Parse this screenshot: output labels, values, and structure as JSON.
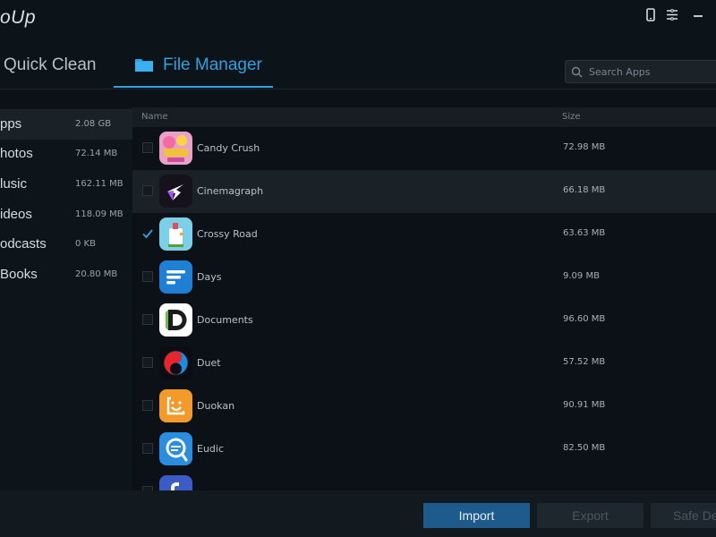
{
  "app": {
    "title": "oUp"
  },
  "tabs": [
    {
      "label": "Quick Clean",
      "active": false
    },
    {
      "label": "File Manager",
      "active": true
    }
  ],
  "search": {
    "placeholder": "Search Apps",
    "value": ""
  },
  "sidebar": {
    "items": [
      {
        "label": "pps",
        "size": "2.08 GB",
        "active": true
      },
      {
        "label": "hotos",
        "size": "72.14 MB",
        "active": false
      },
      {
        "label": "lusic",
        "size": "162.11 MB",
        "active": false
      },
      {
        "label": "ideos",
        "size": "118.09 MB",
        "active": false
      },
      {
        "label": "odcasts",
        "size": "0 KB",
        "active": false
      },
      {
        "label": "Books",
        "size": "20.80 MB",
        "active": false
      }
    ]
  },
  "list": {
    "headers": {
      "name": "Name",
      "size": "Size"
    },
    "rows": [
      {
        "name": "Candy Crush",
        "size": "72.98 MB",
        "checked": false,
        "icon": "candy-crush-icon"
      },
      {
        "name": "Cinemagraph",
        "size": "66.18 MB",
        "checked": false,
        "icon": "cinemagraph-icon"
      },
      {
        "name": "Crossy Road",
        "size": "63.63 MB",
        "checked": true,
        "icon": "crossy-road-icon"
      },
      {
        "name": "Days",
        "size": "9.09 MB",
        "checked": false,
        "icon": "days-icon"
      },
      {
        "name": "Documents",
        "size": "96.60 MB",
        "checked": false,
        "icon": "documents-icon"
      },
      {
        "name": "Duet",
        "size": "57.52 MB",
        "checked": false,
        "icon": "duet-icon"
      },
      {
        "name": "Duokan",
        "size": "90.91 MB",
        "checked": false,
        "icon": "duokan-icon"
      },
      {
        "name": "Eudic",
        "size": "82.50 MB",
        "checked": false,
        "icon": "eudic-icon"
      }
    ]
  },
  "footer": {
    "import_label": "Import",
    "export_label": "Export",
    "safe_delete_label": "Safe De"
  },
  "colors": {
    "accent": "#2ea1e0",
    "background": "#0b1116",
    "import_button": "#1f5a8c"
  }
}
